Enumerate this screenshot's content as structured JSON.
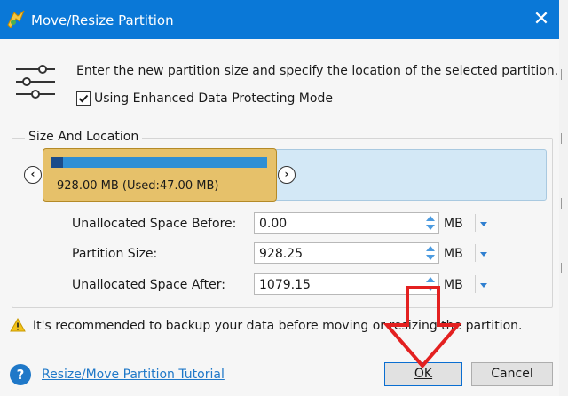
{
  "window": {
    "title": "Move/Resize Partition",
    "close_glyph": "✕"
  },
  "header": {
    "instruction": "Enter the new partition size and specify the location of the selected partition.",
    "checkbox_label": "Using Enhanced Data Protecting Mode",
    "checkbox_checked": true
  },
  "group": {
    "legend": "Size And Location",
    "partition_label": "928.00 MB (Used:47.00 MB)",
    "arrow_left": "‹",
    "arrow_right": "›"
  },
  "fields": [
    {
      "label": "Unallocated Space Before:",
      "value": "0.00",
      "unit": "MB"
    },
    {
      "label": "Partition Size:",
      "value": "928.25",
      "unit": "MB"
    },
    {
      "label": "Unallocated Space After:",
      "value": "1079.15",
      "unit": "MB"
    }
  ],
  "warning": "It's recommended to backup your data before moving or resizing the partition.",
  "footer": {
    "help_glyph": "?",
    "tutorial_link": "Resize/Move Partition Tutorial",
    "ok_label": "OK",
    "cancel_label": "Cancel"
  },
  "colors": {
    "titlebar": "#0a78d7",
    "partition": "#e6c16a",
    "track": "#d3e8f6",
    "annotation_arrow": "#e32020"
  }
}
